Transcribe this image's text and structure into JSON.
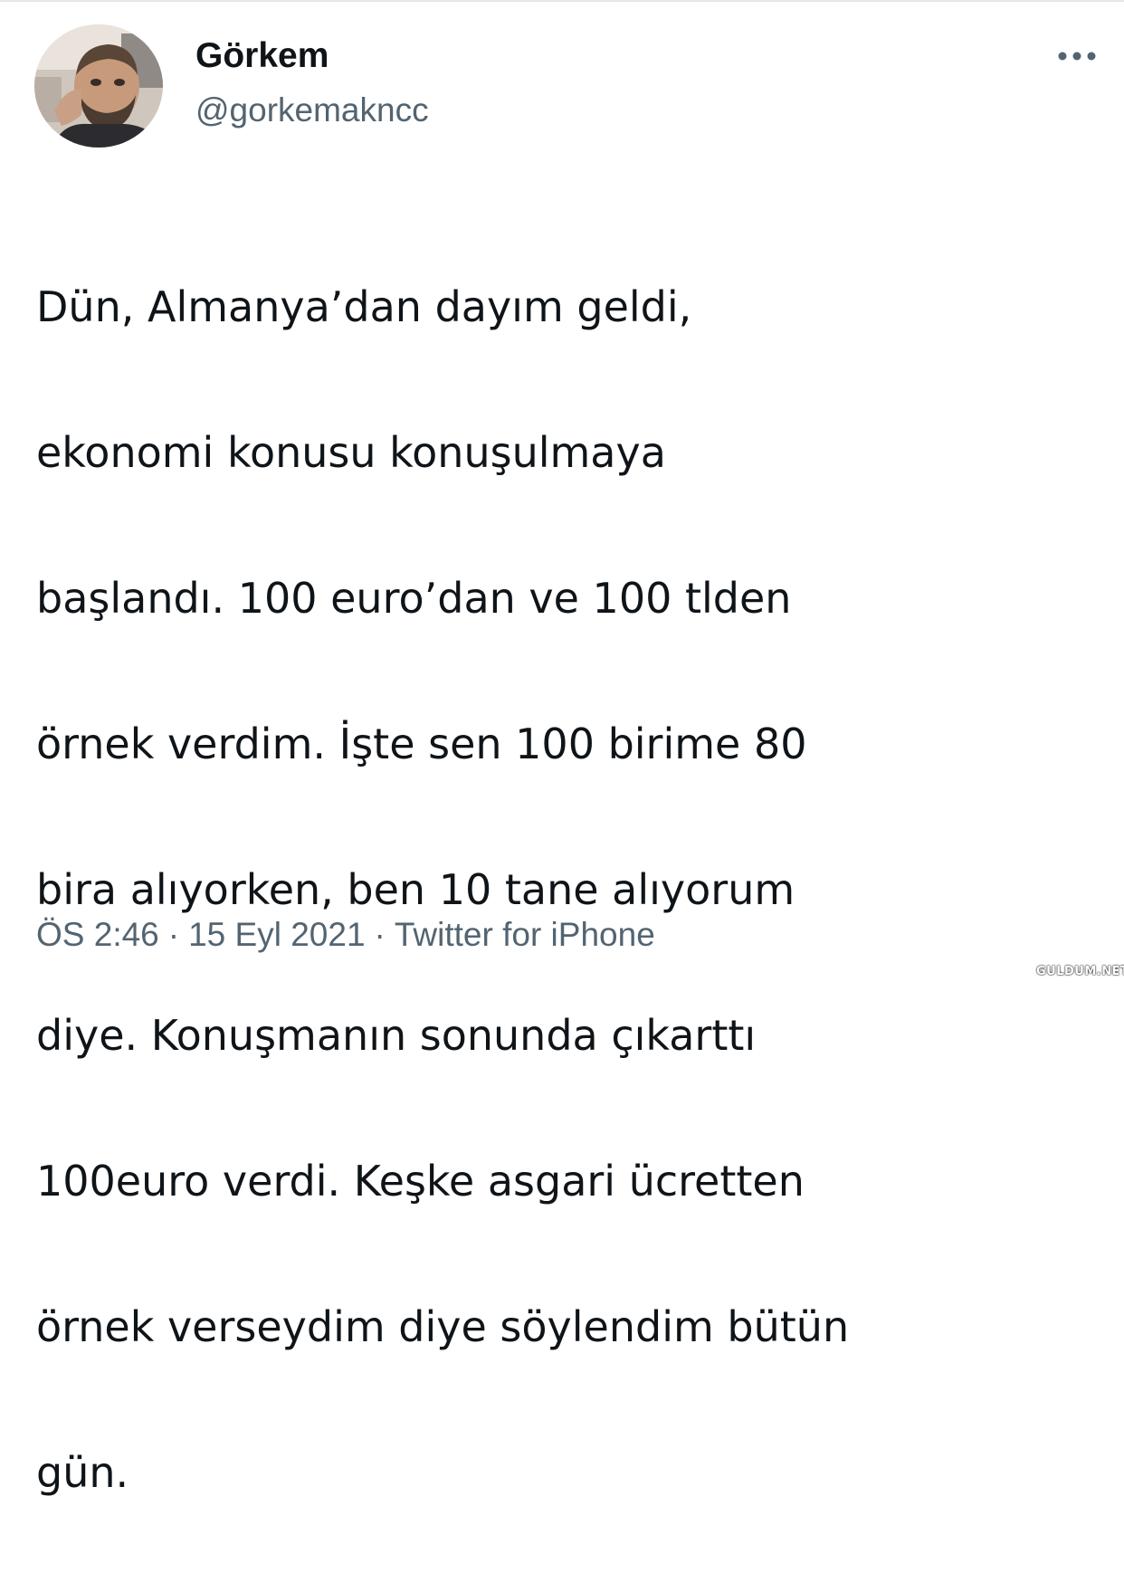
{
  "author": {
    "display_name": "Görkem",
    "handle": "@gorkemakncc",
    "avatar_icon": "profile-photo"
  },
  "more_icon": "more-horizontal-icon",
  "tweet": {
    "lines": [
      "Dün, Almanya’dan dayım geldi,",
      "ekonomi konusu konuşulmaya",
      "başlandı. 100 euro’dan ve 100 tlden",
      "örnek verdim. İşte sen 100 birime 80",
      "bira alıyorken, ben 10 tane alıyorum",
      "diye. Konuşmanın sonunda çıkarttı",
      "100euro verdi. Keşke asgari ücretten",
      "örnek verseydim diye söylendim bütün",
      "gün."
    ]
  },
  "meta": {
    "time": "ÖS 2:46",
    "separator": "·",
    "date": "15 Eyl 2021",
    "source": "Twitter for iPhone"
  },
  "watermark": {
    "text": "GULDUM.NET"
  },
  "colors": {
    "text_primary": "#0f1419",
    "text_secondary": "#536471",
    "background": "#ffffff"
  }
}
